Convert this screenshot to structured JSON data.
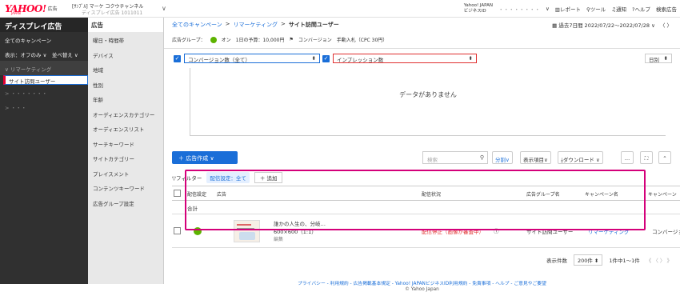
{
  "header": {
    "logo": "YAHOO!",
    "logo_sub": "JAPAN",
    "product_label": "広告",
    "account_name": "[ｻﾝﾌﾟﾙ] マーケ コクウチャンネル",
    "account_sub": "ディスプレイ広告 1011011",
    "user_line1": "Yahoo! JAPAN",
    "user_line2": "ビジネスID",
    "user_masked": "・・・・・・・・",
    "report": "レポート",
    "tools": "ツール",
    "notifications": "通知",
    "help": "ヘルプ",
    "search_ads": "検索広告"
  },
  "sidebar": {
    "title": "ディスプレイ広告",
    "items": [
      {
        "label": "全てのキャンペーン"
      },
      {
        "label": "表示：オフのみ ∨　並べ替え ∨"
      },
      {
        "label": "∨ リマーケティング"
      },
      {
        "label": "サイト訪問ユーザー"
      },
      {
        "label": "> ・・・・・・・"
      },
      {
        "label": "> ・・・"
      }
    ]
  },
  "menu": {
    "title": "広告",
    "items": [
      {
        "label": "曜日・時間帯"
      },
      {
        "label": "デバイス"
      },
      {
        "label": "地域"
      },
      {
        "label": "性別"
      },
      {
        "label": "年齢"
      },
      {
        "label": "オーディエンスカテゴリー"
      },
      {
        "label": "オーディエンスリスト"
      },
      {
        "label": "サーチキーワード"
      },
      {
        "label": "サイトカテゴリー"
      },
      {
        "label": "プレイスメント"
      },
      {
        "label": "コンテンツキーワード"
      },
      {
        "label": "広告グループ設定"
      }
    ]
  },
  "breadcrumb": {
    "all": "全てのキャンペーン",
    "sep": ">",
    "campaign": "リマーケティング",
    "current": "サイト訪問ユーザー"
  },
  "date_range": "過去7日間 2022/07/22〜2022/07/28",
  "adgroup_info": {
    "label": "広告グループ：",
    "status": "オン",
    "budget": "1日の予算：10,000円",
    "conversion": "コンバージョン",
    "bid": "手動入札（CPC 30円）"
  },
  "metric1": "コンバージョン数（全て）",
  "metric2": "インプレッション数",
  "daily": "日別",
  "no_data": "データがありません",
  "toolbar": {
    "create": "＋ 広告作成 ∨",
    "search_placeholder": "検索",
    "segment": "分割∨",
    "columns": "表示項目∨",
    "download": "ダウンロード ∨",
    "more": "…"
  },
  "filter": {
    "label": "▽フィルター",
    "chip": "配信設定：全て",
    "add": "＋ 追加"
  },
  "table": {
    "headers": {
      "delivery": "配信設定",
      "ad": "広告",
      "status": "配信状況",
      "adgroup": "広告グループ名",
      "campaign": "キャンペーン名",
      "campaign2": "キャンペーン"
    },
    "total": "合計",
    "rows": [
      {
        "ad_title": "誰かの人生の、分岐…",
        "ad_size": "600×600（1:1）",
        "ad_edit": "編集",
        "status": "配信停止（画像が審査中）",
        "adgroup": "サイト訪問ユーザー",
        "campaign": "リマーケティング",
        "campaign2": "コンバージョ"
      }
    ]
  },
  "pager": {
    "per_page_label": "表示件数",
    "per_page": "200件",
    "range": "1件中1〜1件",
    "nav": "《 〈 〉 》"
  },
  "footer": {
    "links": "プライバシー - 利用規約 - 広告掲載基本規定 - Yahoo! JAPANビジネスID利用規約 - 免責事項 - ヘルプ - ご意見やご要望",
    "copyright": "© Yahoo Japan"
  },
  "colors": {
    "brand": "#ff0033",
    "accent": "#1a6ed8",
    "highlight": "#d4007a",
    "status_on": "#5db300",
    "error": "#e03030"
  }
}
